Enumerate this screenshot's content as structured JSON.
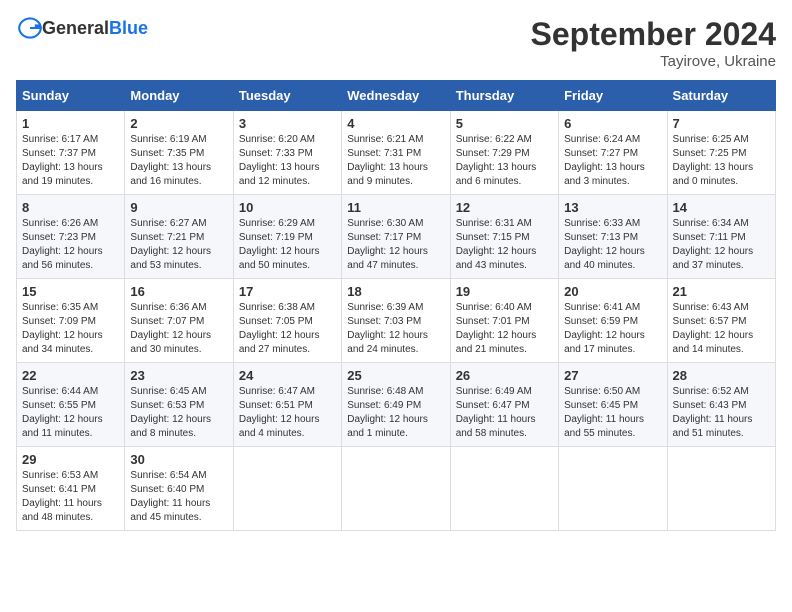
{
  "header": {
    "logo_general": "General",
    "logo_blue": "Blue",
    "month_title": "September 2024",
    "location": "Tayirove, Ukraine"
  },
  "days_of_week": [
    "Sunday",
    "Monday",
    "Tuesday",
    "Wednesday",
    "Thursday",
    "Friday",
    "Saturday"
  ],
  "weeks": [
    [
      {
        "day": "1",
        "sunrise": "Sunrise: 6:17 AM",
        "sunset": "Sunset: 7:37 PM",
        "daylight": "Daylight: 13 hours and 19 minutes."
      },
      {
        "day": "2",
        "sunrise": "Sunrise: 6:19 AM",
        "sunset": "Sunset: 7:35 PM",
        "daylight": "Daylight: 13 hours and 16 minutes."
      },
      {
        "day": "3",
        "sunrise": "Sunrise: 6:20 AM",
        "sunset": "Sunset: 7:33 PM",
        "daylight": "Daylight: 13 hours and 12 minutes."
      },
      {
        "day": "4",
        "sunrise": "Sunrise: 6:21 AM",
        "sunset": "Sunset: 7:31 PM",
        "daylight": "Daylight: 13 hours and 9 minutes."
      },
      {
        "day": "5",
        "sunrise": "Sunrise: 6:22 AM",
        "sunset": "Sunset: 7:29 PM",
        "daylight": "Daylight: 13 hours and 6 minutes."
      },
      {
        "day": "6",
        "sunrise": "Sunrise: 6:24 AM",
        "sunset": "Sunset: 7:27 PM",
        "daylight": "Daylight: 13 hours and 3 minutes."
      },
      {
        "day": "7",
        "sunrise": "Sunrise: 6:25 AM",
        "sunset": "Sunset: 7:25 PM",
        "daylight": "Daylight: 13 hours and 0 minutes."
      }
    ],
    [
      {
        "day": "8",
        "sunrise": "Sunrise: 6:26 AM",
        "sunset": "Sunset: 7:23 PM",
        "daylight": "Daylight: 12 hours and 56 minutes."
      },
      {
        "day": "9",
        "sunrise": "Sunrise: 6:27 AM",
        "sunset": "Sunset: 7:21 PM",
        "daylight": "Daylight: 12 hours and 53 minutes."
      },
      {
        "day": "10",
        "sunrise": "Sunrise: 6:29 AM",
        "sunset": "Sunset: 7:19 PM",
        "daylight": "Daylight: 12 hours and 50 minutes."
      },
      {
        "day": "11",
        "sunrise": "Sunrise: 6:30 AM",
        "sunset": "Sunset: 7:17 PM",
        "daylight": "Daylight: 12 hours and 47 minutes."
      },
      {
        "day": "12",
        "sunrise": "Sunrise: 6:31 AM",
        "sunset": "Sunset: 7:15 PM",
        "daylight": "Daylight: 12 hours and 43 minutes."
      },
      {
        "day": "13",
        "sunrise": "Sunrise: 6:33 AM",
        "sunset": "Sunset: 7:13 PM",
        "daylight": "Daylight: 12 hours and 40 minutes."
      },
      {
        "day": "14",
        "sunrise": "Sunrise: 6:34 AM",
        "sunset": "Sunset: 7:11 PM",
        "daylight": "Daylight: 12 hours and 37 minutes."
      }
    ],
    [
      {
        "day": "15",
        "sunrise": "Sunrise: 6:35 AM",
        "sunset": "Sunset: 7:09 PM",
        "daylight": "Daylight: 12 hours and 34 minutes."
      },
      {
        "day": "16",
        "sunrise": "Sunrise: 6:36 AM",
        "sunset": "Sunset: 7:07 PM",
        "daylight": "Daylight: 12 hours and 30 minutes."
      },
      {
        "day": "17",
        "sunrise": "Sunrise: 6:38 AM",
        "sunset": "Sunset: 7:05 PM",
        "daylight": "Daylight: 12 hours and 27 minutes."
      },
      {
        "day": "18",
        "sunrise": "Sunrise: 6:39 AM",
        "sunset": "Sunset: 7:03 PM",
        "daylight": "Daylight: 12 hours and 24 minutes."
      },
      {
        "day": "19",
        "sunrise": "Sunrise: 6:40 AM",
        "sunset": "Sunset: 7:01 PM",
        "daylight": "Daylight: 12 hours and 21 minutes."
      },
      {
        "day": "20",
        "sunrise": "Sunrise: 6:41 AM",
        "sunset": "Sunset: 6:59 PM",
        "daylight": "Daylight: 12 hours and 17 minutes."
      },
      {
        "day": "21",
        "sunrise": "Sunrise: 6:43 AM",
        "sunset": "Sunset: 6:57 PM",
        "daylight": "Daylight: 12 hours and 14 minutes."
      }
    ],
    [
      {
        "day": "22",
        "sunrise": "Sunrise: 6:44 AM",
        "sunset": "Sunset: 6:55 PM",
        "daylight": "Daylight: 12 hours and 11 minutes."
      },
      {
        "day": "23",
        "sunrise": "Sunrise: 6:45 AM",
        "sunset": "Sunset: 6:53 PM",
        "daylight": "Daylight: 12 hours and 8 minutes."
      },
      {
        "day": "24",
        "sunrise": "Sunrise: 6:47 AM",
        "sunset": "Sunset: 6:51 PM",
        "daylight": "Daylight: 12 hours and 4 minutes."
      },
      {
        "day": "25",
        "sunrise": "Sunrise: 6:48 AM",
        "sunset": "Sunset: 6:49 PM",
        "daylight": "Daylight: 12 hours and 1 minute."
      },
      {
        "day": "26",
        "sunrise": "Sunrise: 6:49 AM",
        "sunset": "Sunset: 6:47 PM",
        "daylight": "Daylight: 11 hours and 58 minutes."
      },
      {
        "day": "27",
        "sunrise": "Sunrise: 6:50 AM",
        "sunset": "Sunset: 6:45 PM",
        "daylight": "Daylight: 11 hours and 55 minutes."
      },
      {
        "day": "28",
        "sunrise": "Sunrise: 6:52 AM",
        "sunset": "Sunset: 6:43 PM",
        "daylight": "Daylight: 11 hours and 51 minutes."
      }
    ],
    [
      {
        "day": "29",
        "sunrise": "Sunrise: 6:53 AM",
        "sunset": "Sunset: 6:41 PM",
        "daylight": "Daylight: 11 hours and 48 minutes."
      },
      {
        "day": "30",
        "sunrise": "Sunrise: 6:54 AM",
        "sunset": "Sunset: 6:40 PM",
        "daylight": "Daylight: 11 hours and 45 minutes."
      },
      null,
      null,
      null,
      null,
      null
    ]
  ]
}
